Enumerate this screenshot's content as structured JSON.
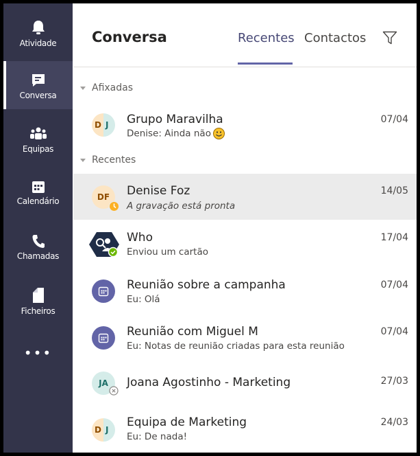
{
  "rail": {
    "items": [
      {
        "label": "Atividade",
        "icon": "bell-icon"
      },
      {
        "label": "Conversa",
        "icon": "chat-icon"
      },
      {
        "label": "Equipas",
        "icon": "teams-icon"
      },
      {
        "label": "Calendário",
        "icon": "calendar-icon"
      },
      {
        "label": "Chamadas",
        "icon": "phone-icon"
      },
      {
        "label": "Ficheiros",
        "icon": "file-icon"
      }
    ],
    "more": "•••",
    "active_index": 1
  },
  "header": {
    "title": "Conversa",
    "tabs": [
      {
        "label": "Recentes",
        "active": true
      },
      {
        "label": "Contactos",
        "active": false
      }
    ],
    "filter_icon": "filter-icon"
  },
  "sections": {
    "pinned": "Afixadas",
    "recent": "Recentes"
  },
  "chats": [
    {
      "name": "Grupo Maravilha",
      "preview": "Denise: Ainda não",
      "date": "07/04",
      "avatar": "D J",
      "emoji": "smiley-icon"
    },
    {
      "name": "Denise Foz",
      "preview": "A gravação está pronta",
      "date": "14/05",
      "avatar": "DF",
      "status": "away",
      "selected": true
    },
    {
      "name": "Who",
      "preview": "Enviou um cartão",
      "date": "17/04",
      "avatar": "bot",
      "status": "available"
    },
    {
      "name": "Reunião sobre a campanha",
      "preview": "Eu: Olá",
      "date": "07/04",
      "avatar": "meeting-icon"
    },
    {
      "name": "Reunião com Miguel M",
      "preview": "Eu: Notas de reunião criadas para esta reunião",
      "date": "07/04",
      "avatar": "meeting-icon"
    },
    {
      "name": "Joana Agostinho - Marketing",
      "preview": "",
      "date": "27/03",
      "avatar": "JA",
      "status": "offline"
    },
    {
      "name": "Equipa de Marketing",
      "preview": "Eu: De nada!",
      "date": "24/03",
      "avatar": "D J"
    }
  ],
  "colors": {
    "rail_bg": "#33344a",
    "accent": "#6264a7",
    "selected_row": "#ebebeb",
    "away": "#fcb124",
    "available": "#6bb700"
  }
}
